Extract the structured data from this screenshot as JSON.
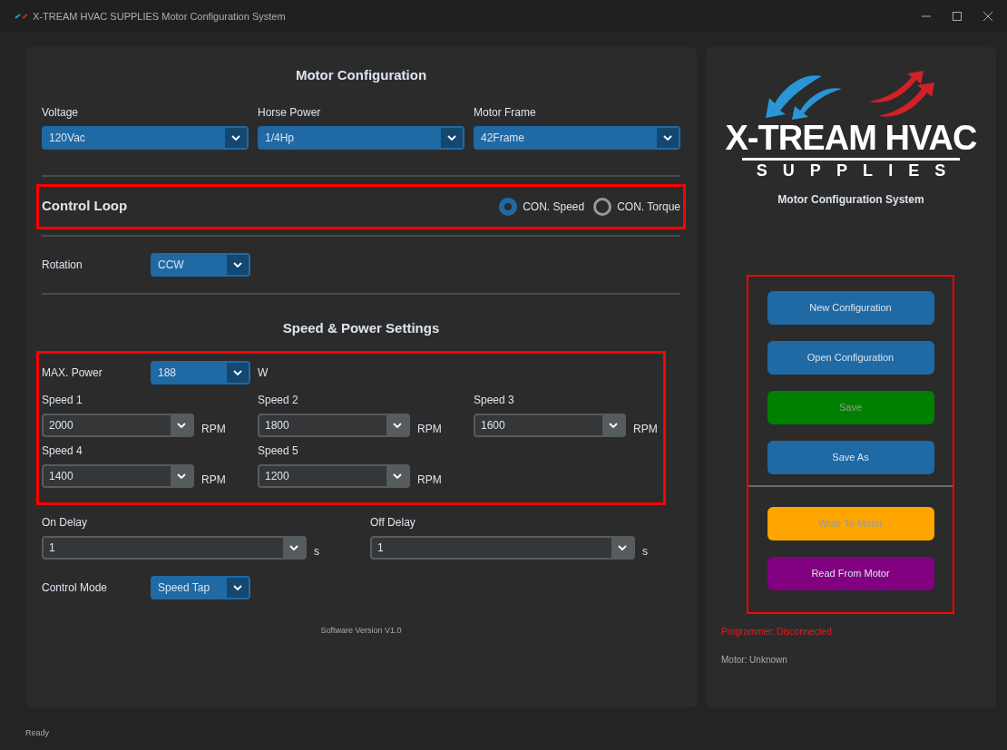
{
  "window": {
    "title": "X-TREAM HVAC SUPPLIES Motor Configuration System"
  },
  "motor_config": {
    "heading": "Motor Configuration",
    "fields": [
      {
        "label": "Voltage",
        "value": "120Vac"
      },
      {
        "label": "Horse Power",
        "value": "1/4Hp"
      },
      {
        "label": "Motor Frame",
        "value": "42Frame"
      }
    ]
  },
  "control_loop": {
    "label": "Control Loop",
    "options": [
      {
        "label": "CON. Speed",
        "selected": true
      },
      {
        "label": "CON. Torque",
        "selected": false
      }
    ]
  },
  "rotation": {
    "label": "Rotation",
    "value": "CCW"
  },
  "speed_power": {
    "heading": "Speed & Power Settings",
    "max_power": {
      "label": "MAX. Power",
      "value": "188",
      "unit": "W"
    },
    "speeds": [
      {
        "label": "Speed 1",
        "value": "2000",
        "unit": "RPM"
      },
      {
        "label": "Speed 2",
        "value": "1800",
        "unit": "RPM"
      },
      {
        "label": "Speed 3",
        "value": "1600",
        "unit": "RPM"
      },
      {
        "label": "Speed 4",
        "value": "1400",
        "unit": "RPM"
      },
      {
        "label": "Speed 5",
        "value": "1200",
        "unit": "RPM"
      }
    ]
  },
  "delays": [
    {
      "label": "On Delay",
      "value": "1",
      "unit": "s"
    },
    {
      "label": "Off Delay",
      "value": "1",
      "unit": "s"
    }
  ],
  "control_mode": {
    "label": "Control Mode",
    "value": "Speed Tap"
  },
  "version": "Software Version V1.0",
  "sidebar": {
    "logo_line1": "X-TREAM HVAC",
    "logo_line2": "SUPPLIES",
    "subtitle": "Motor Configuration System",
    "buttons": [
      {
        "label": "New Configuration",
        "kind": "primary",
        "disabled": false
      },
      {
        "label": "Open Configuration",
        "kind": "primary",
        "disabled": false
      },
      {
        "label": "Save",
        "kind": "success",
        "disabled": true
      },
      {
        "label": "Save As",
        "kind": "primary",
        "disabled": false
      },
      {
        "label": "Write To Motor",
        "kind": "warning",
        "disabled": true
      },
      {
        "label": "Read From Motor",
        "kind": "purple",
        "disabled": false
      }
    ],
    "programmer_status": "Programmer: Disconnected",
    "motor_status": "Motor: Unknown"
  },
  "status_bar": "Ready"
}
